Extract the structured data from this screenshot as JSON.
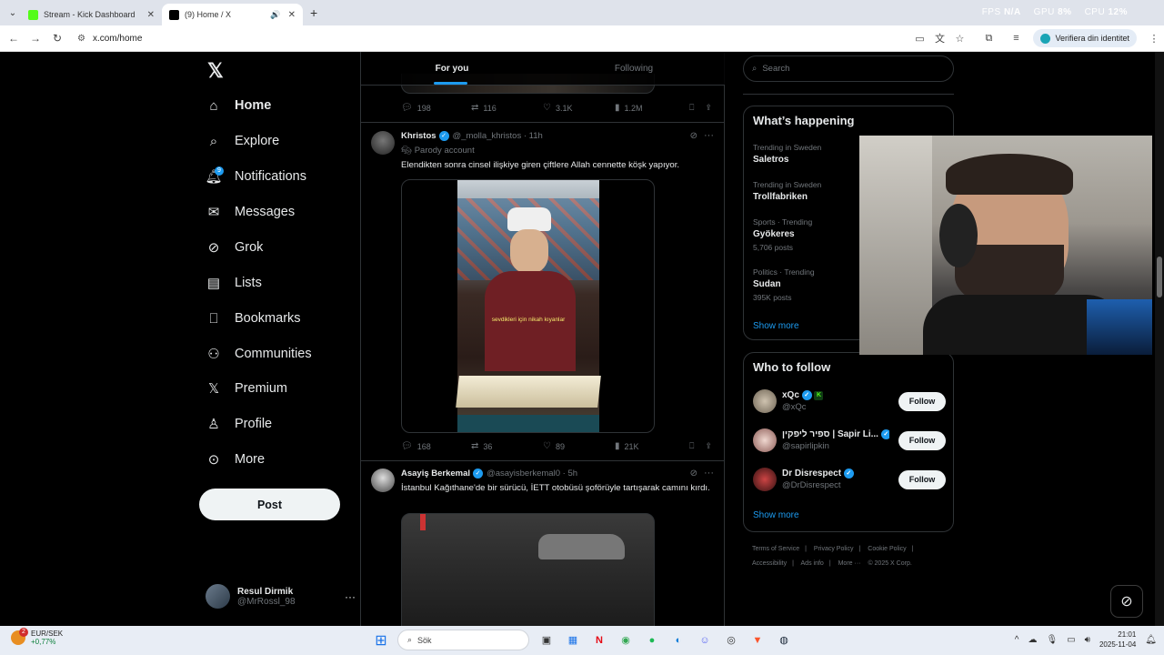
{
  "browser": {
    "tabs": [
      {
        "title": "Stream - Kick Dashboard",
        "active": false
      },
      {
        "title": "(9) Home / X",
        "active": true
      }
    ],
    "sysmon": {
      "fps_label": "FPS",
      "fps_value": "N/A",
      "gpu_label": "GPU",
      "gpu_value": "8%",
      "cpu_label": "CPU",
      "cpu_value": "12%"
    },
    "url": "x.com/home",
    "verify_label": "Verifiera din identitet"
  },
  "nav": {
    "items": [
      {
        "label": "Home",
        "icon": "home-icon"
      },
      {
        "label": "Explore",
        "icon": "search-icon"
      },
      {
        "label": "Notifications",
        "icon": "bell-icon",
        "badge": "9"
      },
      {
        "label": "Messages",
        "icon": "mail-icon"
      },
      {
        "label": "Grok",
        "icon": "grok-icon"
      },
      {
        "label": "Lists",
        "icon": "list-icon"
      },
      {
        "label": "Bookmarks",
        "icon": "bookmark-icon"
      },
      {
        "label": "Communities",
        "icon": "people-icon"
      },
      {
        "label": "Premium",
        "icon": "x-icon"
      },
      {
        "label": "Profile",
        "icon": "person-icon"
      },
      {
        "label": "More",
        "icon": "more-circle-icon"
      }
    ],
    "post_label": "Post",
    "account": {
      "name": "Resul Dirmik",
      "handle": "@MrRossl_98"
    }
  },
  "feed": {
    "tabs": [
      "For you",
      "Following"
    ],
    "prev_actions": {
      "replies": "198",
      "reposts": "116",
      "likes": "3.1K",
      "views": "1.2M"
    },
    "tweets": [
      {
        "name": "Khristos",
        "handle": "@_molla_khristos",
        "time": "11h",
        "sub": "Parody account",
        "text": "Elendikten sonra cinsel ilişkiye giren çiftlere Allah cennette köşk yapıyor.",
        "caption": "sevdikleri için nikah kıyanlar",
        "actions": {
          "replies": "168",
          "reposts": "36",
          "likes": "89",
          "views": "21K"
        }
      },
      {
        "name": "Asayiş Berkemal",
        "handle": "@asayisberkemal0",
        "time": "5h",
        "text": "İstanbul Kağıthane'de bir sürücü, İETT otobüsü şoförüyle tartışarak camını kırdı."
      }
    ]
  },
  "right": {
    "search_placeholder": "Search",
    "happening_title": "What’s happening",
    "trends": [
      {
        "context": "Trending in Sweden",
        "topic": "Saletros",
        "posts": ""
      },
      {
        "context": "Trending in Sweden",
        "topic": "Trollfabriken",
        "posts": ""
      },
      {
        "context": "Sports · Trending",
        "topic": "Gyökeres",
        "posts": "5,706 posts"
      },
      {
        "context": "Politics · Trending",
        "topic": "Sudan",
        "posts": "395K posts"
      }
    ],
    "show_more": "Show more",
    "who_title": "Who to follow",
    "who": [
      {
        "name": "xQc",
        "handle": "@xQc"
      },
      {
        "name": "ספיר ליפקין | Sapir Li...",
        "handle": "@sapirlipkin"
      },
      {
        "name": "Dr Disrespect",
        "handle": "@DrDisrespect"
      }
    ],
    "follow_label": "Follow",
    "footer": [
      "Terms of Service",
      "|",
      "Privacy Policy",
      "|",
      "Cookie Policy",
      "|",
      "Accessibility",
      "|",
      "Ads info",
      "|",
      "More ···",
      "© 2025 X Corp."
    ]
  },
  "taskbar": {
    "ticker_name": "EUR/SEK",
    "ticker_value": "+0,77%",
    "ticker_badge": "2",
    "search_placeholder": "Sök",
    "time": "21:01",
    "date": "2025-11-04"
  }
}
